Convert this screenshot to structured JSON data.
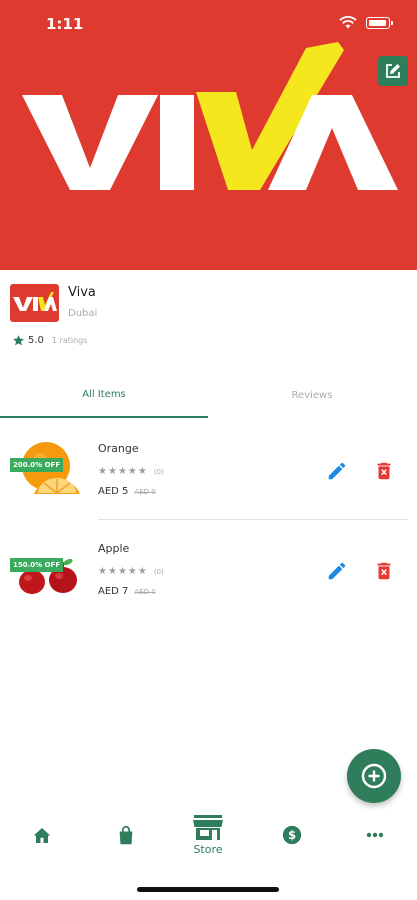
{
  "status_bar": {
    "time": "1:11"
  },
  "banner": {
    "brand_text": "VIVA",
    "brand_colors": {
      "background": "#de3a2f",
      "letters": "#ffffff",
      "check": "#f5e71e"
    }
  },
  "store": {
    "logo_text": "VIVA",
    "name": "Viva",
    "location": "Dubai",
    "rating": "5.0",
    "ratings_count": "1 ratings"
  },
  "tabs": [
    {
      "label": "All Items",
      "active": true
    },
    {
      "label": "Reviews",
      "active": false
    }
  ],
  "items": [
    {
      "name": "Orange",
      "badge": "200.0% OFF",
      "review_count": "(0)",
      "price": "AED 5",
      "old_price": "AED 0"
    },
    {
      "name": "Apple",
      "badge": "150.0% OFF",
      "review_count": "(0)",
      "price": "AED 7",
      "old_price": "AED 0"
    }
  ],
  "bottom_nav": [
    {
      "icon": "home-icon",
      "label": ""
    },
    {
      "icon": "shopping-bag-icon",
      "label": ""
    },
    {
      "icon": "store-icon",
      "label": "Store"
    },
    {
      "icon": "dollar-icon",
      "label": ""
    },
    {
      "icon": "more-icon",
      "label": ""
    }
  ],
  "colors": {
    "accent": "#2e7d5b",
    "edit": "#1e88e5",
    "delete": "#e53935",
    "badge": "#3aaa5c"
  }
}
